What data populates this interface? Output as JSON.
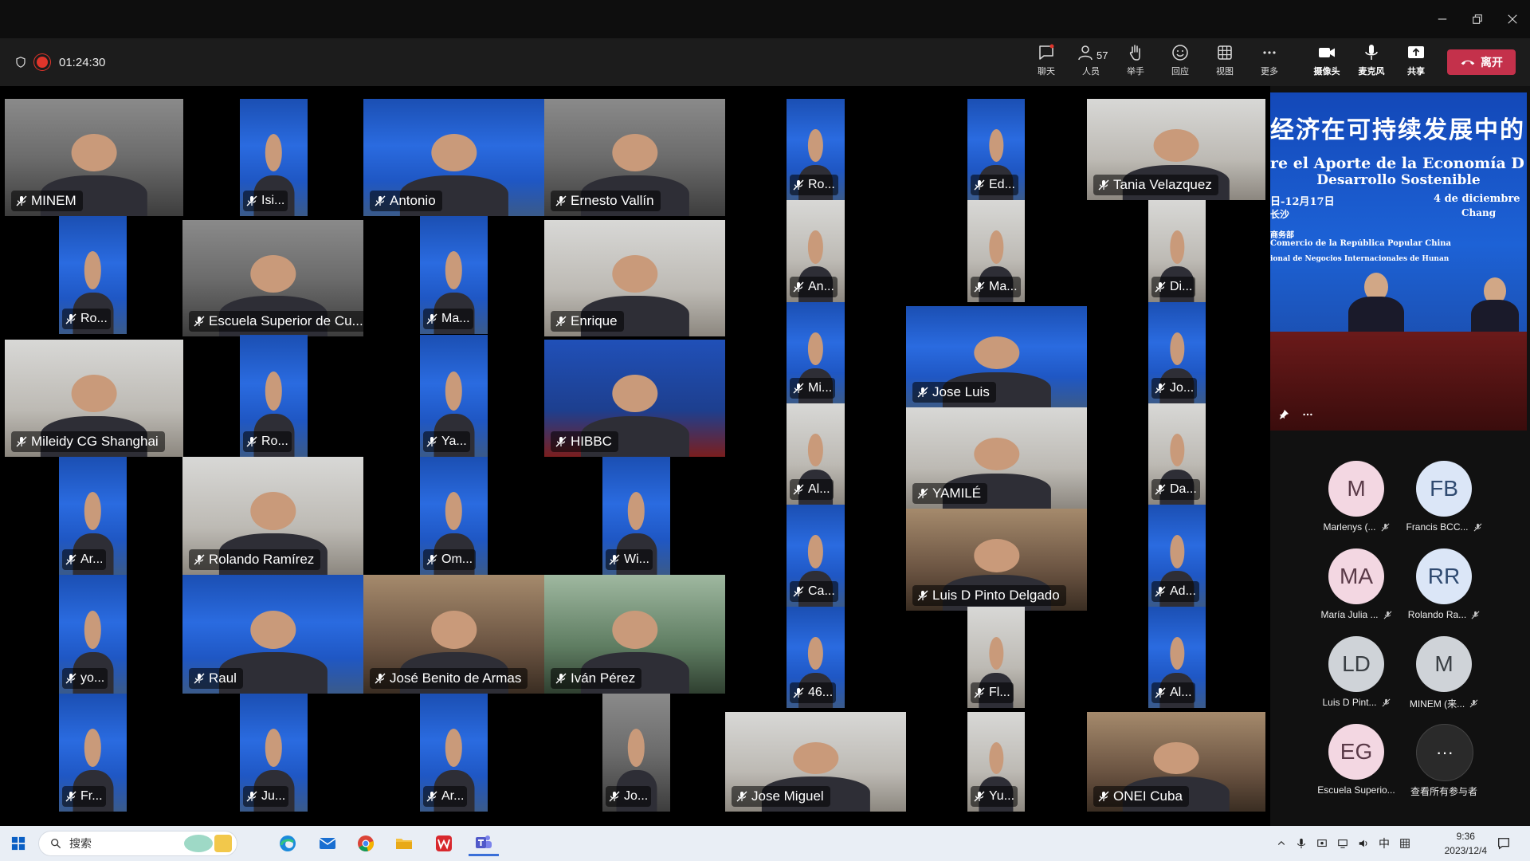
{
  "window": {
    "controls": [
      "minimize",
      "restore",
      "close"
    ]
  },
  "toolbar": {
    "timer": "01:24:30",
    "buttons": [
      {
        "id": "chat",
        "label": "聊天",
        "icon": "chat-icon"
      },
      {
        "id": "people",
        "label": "人员",
        "icon": "people-icon",
        "count": "57"
      },
      {
        "id": "raise-hand",
        "label": "举手",
        "icon": "hand-icon"
      },
      {
        "id": "react",
        "label": "回应",
        "icon": "smiley-icon"
      },
      {
        "id": "view",
        "label": "视图",
        "icon": "grid-icon"
      },
      {
        "id": "more",
        "label": "更多",
        "icon": "more-icon"
      },
      {
        "id": "camera",
        "label": "摄像头",
        "icon": "camera-icon"
      },
      {
        "id": "mic",
        "label": "麦克风",
        "icon": "mic-icon"
      },
      {
        "id": "share",
        "label": "共享",
        "icon": "share-icon"
      }
    ],
    "leave_label": "离开"
  },
  "participants": [
    {
      "name": "MINEM",
      "style": "room"
    },
    {
      "name": "Isi...",
      "style": "blue"
    },
    {
      "name": "Antonio",
      "style": "blue"
    },
    {
      "name": "Ernesto Vallín",
      "style": "room"
    },
    {
      "name": "Ro...",
      "style": "blue"
    },
    {
      "name": "Ed...",
      "style": "blue"
    },
    {
      "name": "Tania Velazquez",
      "style": "light"
    },
    {
      "name": "Ro...",
      "style": "blue"
    },
    {
      "name": "Escuela Superior de Cu...",
      "style": "room"
    },
    {
      "name": "Ma...",
      "style": "blue"
    },
    {
      "name": "Enrique",
      "style": "light"
    },
    {
      "name": "An...",
      "style": "light"
    },
    {
      "name": "Ma...",
      "style": "light"
    },
    {
      "name": "Di...",
      "style": "light"
    },
    {
      "name": "Mileidy CG Shanghai",
      "style": "light"
    },
    {
      "name": "Ro...",
      "style": "blue"
    },
    {
      "name": "Ya...",
      "style": "blue"
    },
    {
      "name": "HIBBC",
      "style": "red"
    },
    {
      "name": "Mi...",
      "style": "blue"
    },
    {
      "name": "Jose Luis",
      "style": "blue"
    },
    {
      "name": "Jo...",
      "style": "blue"
    },
    {
      "name": "Ar...",
      "style": "blue"
    },
    {
      "name": "Rolando Ramírez",
      "style": "light"
    },
    {
      "name": "Om...",
      "style": "blue"
    },
    {
      "name": "Wi...",
      "style": "blue"
    },
    {
      "name": "Al...",
      "style": "light"
    },
    {
      "name": "YAMILÉ",
      "style": "light"
    },
    {
      "name": "Da...",
      "style": "light"
    },
    {
      "name": "Ca...",
      "style": "blue"
    },
    {
      "name": "Luis D Pinto Delgado",
      "style": "warm"
    },
    {
      "name": "Ad...",
      "style": "blue"
    },
    {
      "name": "yo...",
      "style": "blue"
    },
    {
      "name": "Raul",
      "style": "blue"
    },
    {
      "name": "José Benito de Armas",
      "style": "warm"
    },
    {
      "name": "Iván Pérez",
      "style": "green"
    },
    {
      "name": "46...",
      "style": "blue"
    },
    {
      "name": "Fl...",
      "style": "light"
    },
    {
      "name": "Al...",
      "style": "blue"
    },
    {
      "name": "Fr...",
      "style": "blue"
    },
    {
      "name": "Ju...",
      "style": "blue"
    },
    {
      "name": "Ar...",
      "style": "blue"
    },
    {
      "name": "Jo...",
      "style": "room"
    },
    {
      "name": "Jose Miguel",
      "style": "light"
    },
    {
      "name": "Yu...",
      "style": "light"
    },
    {
      "name": "ONEI Cuba",
      "style": "warm"
    }
  ],
  "spotlight": {
    "line1": "经济在可持续发展中的",
    "line2": "re el Aporte de la Economía D",
    "line3": "Desarrollo Sostenible",
    "line4_left": "日-12月17日",
    "line4_right": "4 de diciembre",
    "line5_left": "长沙",
    "line5_right": "Chang",
    "line6": "商务部",
    "line7": "Comercio de la República Popular China",
    "line8": "ional de Negocios Internacionales de Hunan"
  },
  "side_participants": [
    {
      "initials": "M",
      "name": "Marlenys (...",
      "color": "pink"
    },
    {
      "initials": "FB",
      "name": "Francis BCC...",
      "color": "blue"
    },
    {
      "initials": "MA",
      "name": "María Julia ...",
      "color": "pink"
    },
    {
      "initials": "RR",
      "name": "Rolando Ra...",
      "color": "blue"
    },
    {
      "initials": "LD",
      "name": "Luis D Pint...",
      "color": "gray"
    },
    {
      "initials": "M",
      "name": "MINEM (来...",
      "color": "gray"
    },
    {
      "initials": "EG",
      "name": "Escuela Superio...",
      "color": "pink"
    }
  ],
  "view_all_label": "查看所有参与者",
  "taskbar": {
    "search_placeholder": "搜索",
    "ime": "中",
    "time": "9:36",
    "date": "2023/12/4"
  }
}
